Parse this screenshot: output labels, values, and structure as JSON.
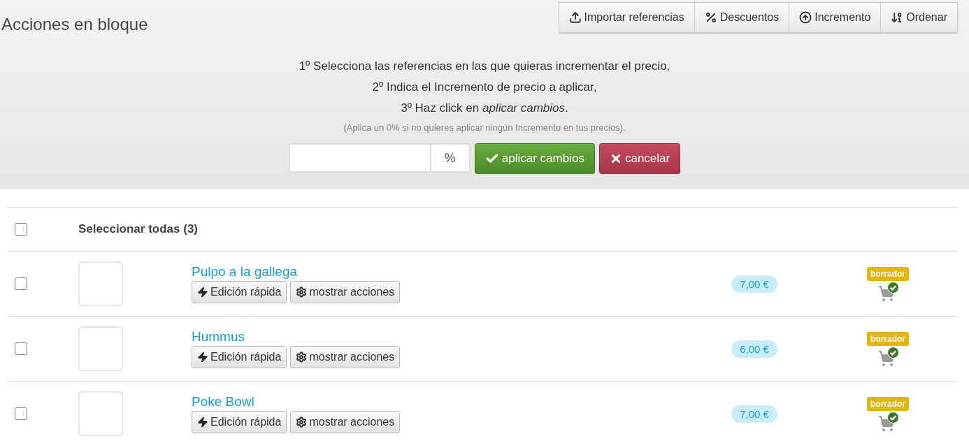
{
  "title": "Acciones en bloque",
  "toolbar": [
    {
      "kind": "import",
      "label": "Importar referencias"
    },
    {
      "kind": "discount",
      "label": "Descuentos"
    },
    {
      "kind": "increment",
      "label": "Incremento"
    },
    {
      "kind": "sort",
      "label": "Ordenar"
    }
  ],
  "instructions": [
    "1º Selecciona las referencias en las que quieras incrementar el precio,",
    "2º Indica el Incremento de precio a aplicar,",
    "3º Haz click en *aplicar cambios*."
  ],
  "note": "(Aplica un 0% si no quieres aplicar ningún Incremento en tus precios).",
  "increment_field": {
    "unit": "%"
  },
  "apply_button": "aplicar cambios",
  "cancel_button": "cancelar",
  "select_all": {
    "label": "Seleccionar todas (3)",
    "checked": false
  },
  "products": [
    {
      "name": "Pulpo a la gallega",
      "checked": false,
      "quick_edit": "Edición rápida",
      "actions": "mostrar acciones",
      "price": "7,00 €",
      "status": "borrador"
    },
    {
      "name": "Hummus",
      "checked": false,
      "quick_edit": "Edición rápida",
      "actions": "mostrar acciones",
      "price": "6,00 €",
      "status": "borrador"
    },
    {
      "name": "Poke Bowl",
      "checked": false,
      "quick_edit": "Edición rápida",
      "actions": "mostrar acciones",
      "price": "7,00 €",
      "status": "borrador"
    }
  ]
}
